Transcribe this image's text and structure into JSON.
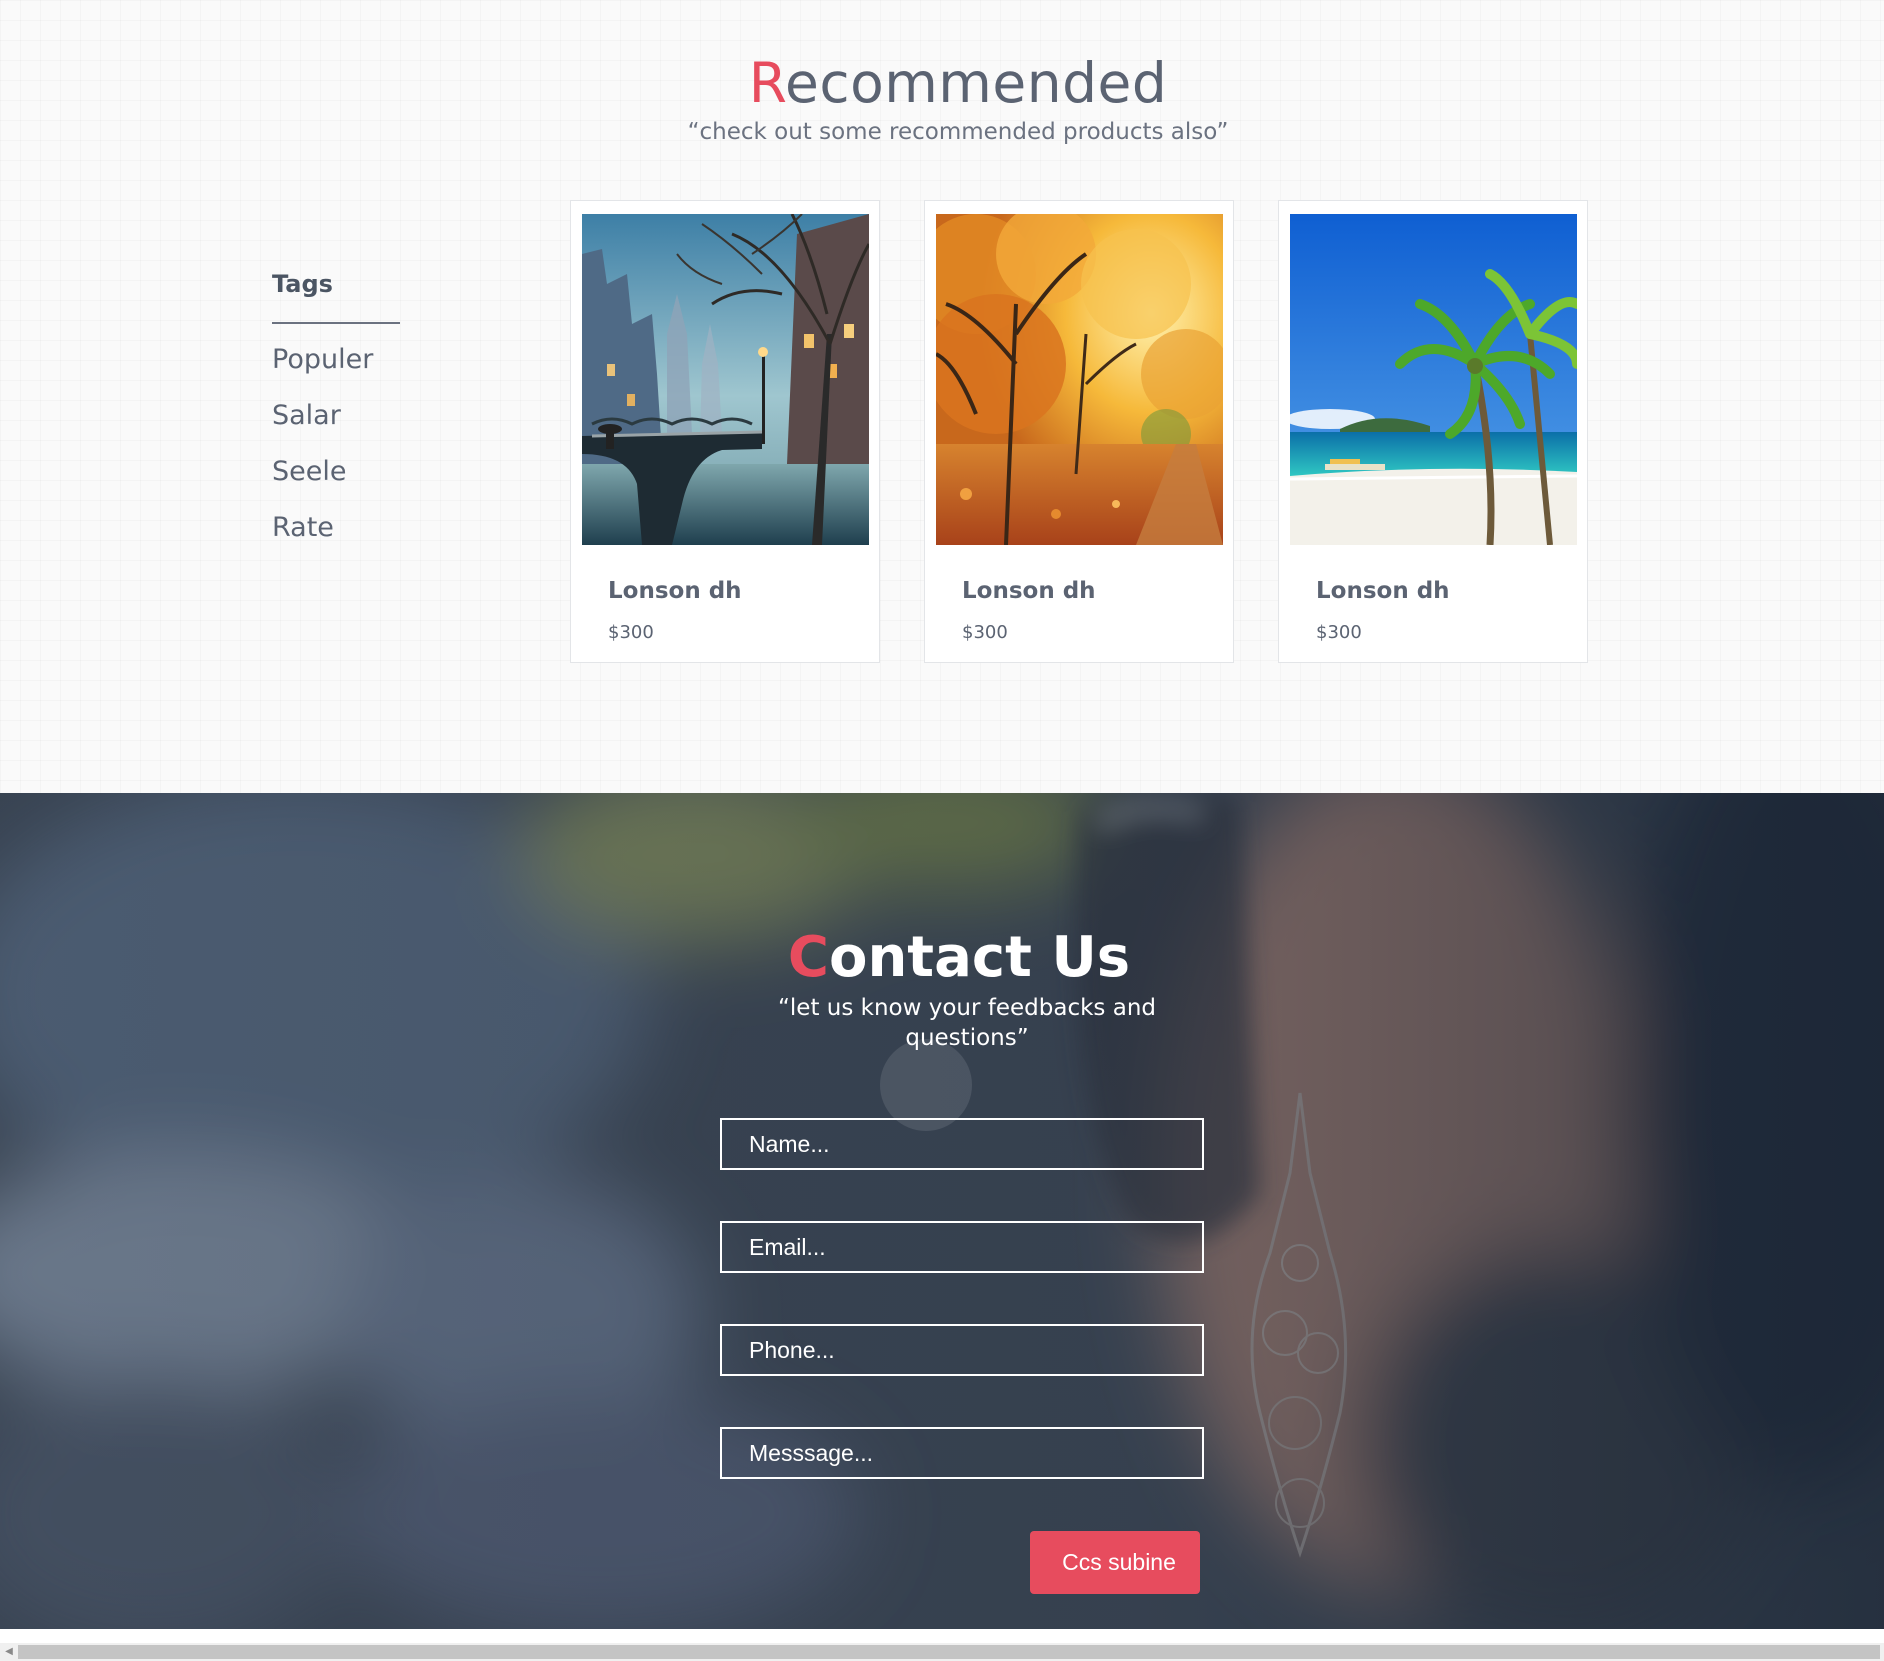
{
  "recommended": {
    "title_first": "R",
    "title_rest": "ecommended",
    "subtitle": "“check out some recommended products also”"
  },
  "tags": {
    "title": "Tags",
    "items": [
      "Populer",
      "Salar",
      "Seele",
      "Rate"
    ]
  },
  "products": [
    {
      "name": "Lonson dh",
      "price": "$300",
      "image": "rainy-canal-bridge-painting"
    },
    {
      "name": "Lonson dh",
      "price": "$300",
      "image": "autumn-forest-path"
    },
    {
      "name": "Lonson dh",
      "price": "$300",
      "image": "tropical-beach-palm-trees"
    }
  ],
  "contact": {
    "title_first": "C",
    "title_rest": "ontact Us",
    "subtitle": "“let us know your feedbacks and questions”",
    "name_placeholder": "Name...",
    "email_placeholder": "Email...",
    "phone_placeholder": "Phone...",
    "message_placeholder": "Messsage...",
    "submit_label": "Ccs subine",
    "background_image": "blurred-woman-with-sunglasses-and-earring"
  },
  "colors": {
    "accent": "#e74c5e",
    "text": "#5b6372",
    "contact_overlay": "#2a3341"
  }
}
